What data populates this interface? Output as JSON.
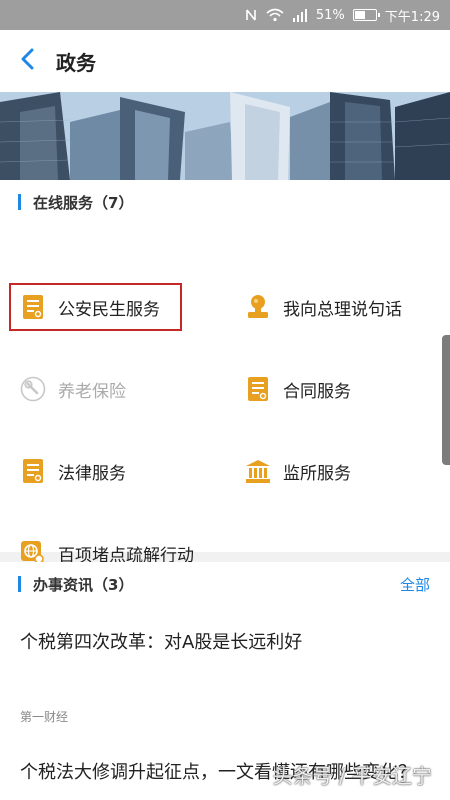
{
  "status_bar": {
    "battery": "51%",
    "battery_level": 0.51,
    "time": "下午1:29",
    "icons": [
      "nfc-icon",
      "wifi-icon",
      "signal-icon",
      "battery-icon"
    ]
  },
  "header": {
    "back_icon": "chevron-left-icon",
    "title": "政务"
  },
  "online_services": {
    "title": "在线服务（7）",
    "items": [
      {
        "label": "公安民生服务",
        "icon": "document-icon",
        "highlighted": true
      },
      {
        "label": "我向总理说句话",
        "icon": "stamp-icon"
      },
      {
        "label": "养老保险",
        "icon": "wrench-icon",
        "disabled": true
      },
      {
        "label": "合同服务",
        "icon": "document-icon"
      },
      {
        "label": "法律服务",
        "icon": "document-icon"
      },
      {
        "label": "监所服务",
        "icon": "building-icon"
      },
      {
        "label": "百项堵点疏解行动",
        "icon": "globe-search-icon"
      }
    ]
  },
  "news": {
    "title": "办事资讯（3）",
    "more_label": "全部",
    "items": [
      {
        "title": "个税第四次改革：对A股是长远利好",
        "source": "第一财经"
      },
      {
        "title": "个税法大修调升起征点，一文看懂还有哪些变化？"
      }
    ]
  },
  "watermark": "头条号 / 平安辽宁",
  "colors": {
    "accent": "#1e88e5",
    "icon": "#e8a020",
    "highlight_border": "#c62828",
    "status_bar": "#9e9e9e"
  }
}
